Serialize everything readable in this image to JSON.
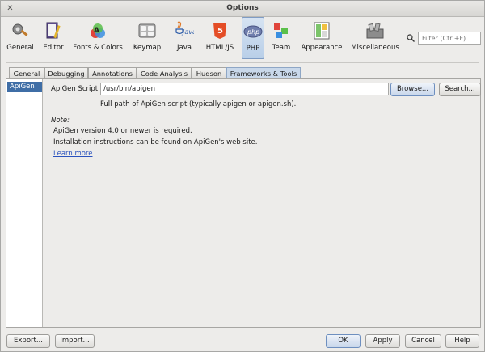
{
  "window": {
    "title": "Options",
    "close_glyph": "✕"
  },
  "toolbar": {
    "items": [
      {
        "label": "General",
        "icon": "general-icon"
      },
      {
        "label": "Editor",
        "icon": "editor-icon"
      },
      {
        "label": "Fonts & Colors",
        "icon": "fonts-colors-icon"
      },
      {
        "label": "Keymap",
        "icon": "keymap-icon"
      },
      {
        "label": "Java",
        "icon": "java-icon"
      },
      {
        "label": "HTML/JS",
        "icon": "html5-icon"
      },
      {
        "label": "PHP",
        "icon": "php-icon",
        "selected": true
      },
      {
        "label": "Team",
        "icon": "team-icon"
      },
      {
        "label": "Appearance",
        "icon": "appearance-icon"
      },
      {
        "label": "Miscellaneous",
        "icon": "miscellaneous-icon"
      }
    ],
    "icon_text": {
      "java": "Java",
      "php": "php",
      "html5": "5"
    }
  },
  "filter": {
    "placeholder": "Filter (Ctrl+F)"
  },
  "tabs": [
    {
      "label": "General"
    },
    {
      "label": "Debugging"
    },
    {
      "label": "Annotations"
    },
    {
      "label": "Code Analysis"
    },
    {
      "label": "Hudson"
    },
    {
      "label": "Frameworks & Tools",
      "selected": true
    }
  ],
  "sidebar": {
    "items": [
      {
        "label": "ApiGen",
        "selected": true
      }
    ]
  },
  "apigen": {
    "script_label": "ApiGen Script:",
    "script_value": "/usr/bin/apigen",
    "browse_label": "Browse...",
    "search_label": "Search...",
    "hint": "Full path of ApiGen script (typically apigen or apigen.sh).",
    "note_title": "Note:",
    "note_line1": "ApiGen version 4.0 or newer is required.",
    "note_line2": "Installation instructions can be found on ApiGen's web site.",
    "learn_more": "Learn more"
  },
  "footer": {
    "export": "Export...",
    "import": "Import...",
    "ok": "OK",
    "apply": "Apply",
    "cancel": "Cancel",
    "help": "Help"
  },
  "colors": {
    "accent": "#3f6ea6",
    "link": "#2a52be",
    "selected_tab": "#c9d8ea"
  }
}
